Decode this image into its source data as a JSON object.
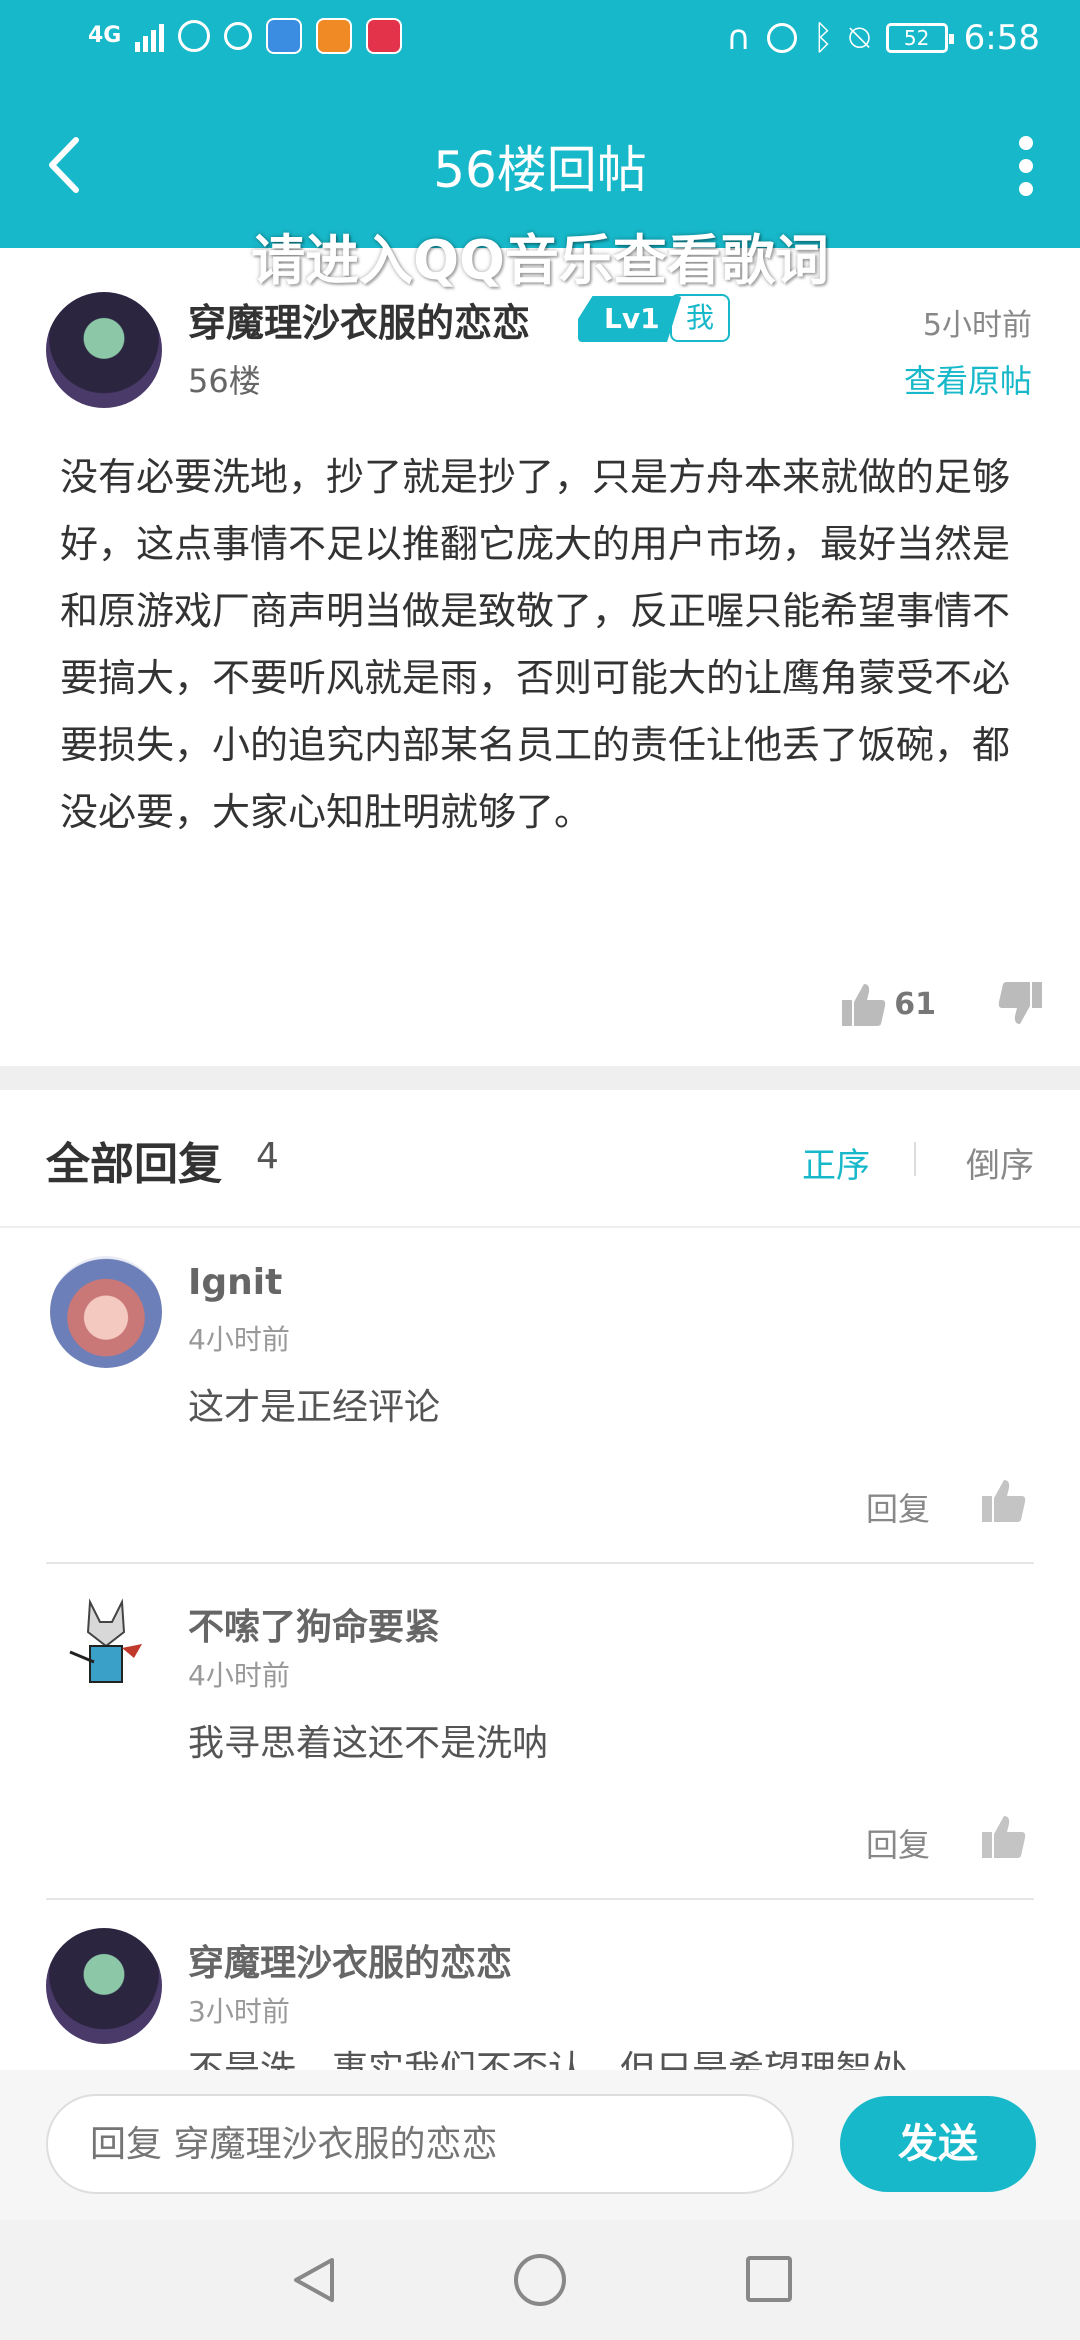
{
  "status_bar": {
    "signal": "4G",
    "battery": "52",
    "time": "6:58",
    "icons": [
      "signal-icon",
      "globe-icon",
      "timer-icon",
      "browser-icon",
      "weibo-icon",
      "qq-music-icon",
      "headset-icon",
      "alarm-icon",
      "bluetooth-icon",
      "mute-icon",
      "battery-icon"
    ]
  },
  "header": {
    "title": "56楼回帖",
    "lyric_overlay": "请进入QQ音乐查看歌词"
  },
  "post": {
    "username": "穿魔理沙衣服的恋恋",
    "level": "Lv1",
    "me_badge": "我",
    "time": "5小时前",
    "floor": "56楼",
    "view_original": "查看原帖",
    "body": "没有必要洗地，抄了就是抄了，只是方舟本来就做的足够好，这点事情不足以推翻它庞大的用户市场，最好当然是和原游戏厂商声明当做是致敬了，反正喔只能希望事情不要搞大，不要听风就是雨，否则可能大的让鹰角蒙受不必要损失，小的追究内部某名员工的责任让他丢了饭碗，都没必要，大家心知肚明就够了。",
    "likes": "61"
  },
  "replies_header": {
    "label": "全部回复",
    "count": "4",
    "sort_asc": "正序",
    "sort_desc": "倒序"
  },
  "replies": [
    {
      "name": "Ignit",
      "time": "4小时前",
      "text": "这才是正经评论",
      "reply_label": "回复"
    },
    {
      "name": "不嗦了狗命要紧",
      "time": "4小时前",
      "text": "我寻思着这还不是洗呐",
      "reply_label": "回复"
    },
    {
      "name": "穿魔理沙衣服的恋恋",
      "time": "3小时前",
      "text": "不是洗，事实我们不否认，但只是希望理智处"
    }
  ],
  "input": {
    "placeholder": "回复 穿魔理沙衣服的恋恋",
    "send_label": "发送"
  },
  "colors": {
    "accent": "#17b8c9"
  }
}
